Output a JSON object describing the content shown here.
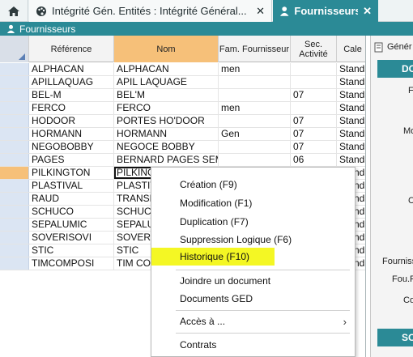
{
  "tabs": [
    {
      "label": "Intégrité Gén. Entités : Intégrité Général...",
      "icon": "palette-icon",
      "active": false
    },
    {
      "label": "Fournisseurs",
      "icon": "supplier-icon",
      "active": true
    }
  ],
  "window_title": "Fournisseurs",
  "columns": [
    "Référence",
    "Nom",
    "Fam. Fournisseur",
    "Sec. Activité",
    "Cale"
  ],
  "rows": [
    {
      "ref": "ALPHACAN",
      "nom": "ALPHACAN",
      "fam": "men",
      "sec": "",
      "cal": "Standa"
    },
    {
      "ref": "APILLAQUAG",
      "nom": "APIL LAQUAGE",
      "fam": "",
      "sec": "",
      "cal": "Standa"
    },
    {
      "ref": "BEL-M",
      "nom": "BEL'M",
      "fam": "",
      "sec": "07",
      "cal": "Standa"
    },
    {
      "ref": "FERCO",
      "nom": "FERCO",
      "fam": "men",
      "sec": "",
      "cal": "Standa"
    },
    {
      "ref": "HODOOR",
      "nom": "PORTES HO'DOOR",
      "fam": "",
      "sec": "07",
      "cal": "Standa"
    },
    {
      "ref": "HORMANN",
      "nom": "HORMANN",
      "fam": "Gen",
      "sec": "07",
      "cal": "Standa"
    },
    {
      "ref": "NEGOBOBBY",
      "nom": "NEGOCE BOBBY",
      "fam": "",
      "sec": "07",
      "cal": "Standa"
    },
    {
      "ref": "PAGES",
      "nom": "BERNARD PAGES SEME",
      "fam": "",
      "sec": "06",
      "cal": "Standa"
    },
    {
      "ref": "PILKINGTON",
      "nom": "PILKING",
      "fam": "",
      "sec": "",
      "cal": "Standa"
    },
    {
      "ref": "PLASTIVAL",
      "nom": "PLASTIV",
      "fam": "",
      "sec": "",
      "cal": "Standa"
    },
    {
      "ref": "RAUD",
      "nom": "TRANSF",
      "fam": "",
      "sec": "",
      "cal": "Standa"
    },
    {
      "ref": "SCHUCO",
      "nom": "SCHUCO",
      "fam": "",
      "sec": "",
      "cal": "Standa"
    },
    {
      "ref": "SEPALUMIC",
      "nom": "SEPALU",
      "fam": "",
      "sec": "",
      "cal": "Standa"
    },
    {
      "ref": "SOVERISOVI",
      "nom": "SOVERIS",
      "fam": "",
      "sec": "",
      "cal": "Standa"
    },
    {
      "ref": "STIC",
      "nom": "STIC",
      "fam": "",
      "sec": "",
      "cal": "Standa"
    },
    {
      "ref": "TIMCOMPOSI",
      "nom": "TIM COM",
      "fam": "",
      "sec": "",
      "cal": "Standa"
    }
  ],
  "active_row": 8,
  "right_panel": {
    "toolbar_label": "Génér",
    "band_top": "DO",
    "band_bottom": "SO",
    "labels": [
      "F",
      "Mo",
      "C",
      "Fournisse",
      "Fou.F",
      "Co"
    ]
  },
  "context_menu": {
    "items": [
      {
        "label": "Création (F9)",
        "highlight": false
      },
      {
        "label": "Modification (F1)",
        "highlight": false
      },
      {
        "label": "Duplication (F7)",
        "highlight": false
      },
      {
        "label": "Suppression Logique (F6)",
        "highlight": false
      },
      {
        "label": "Historique (F10)",
        "highlight": true
      },
      {
        "label": "Joindre un document",
        "highlight": false
      },
      {
        "label": "Documents GED",
        "highlight": false
      },
      {
        "label": "Accès à ...",
        "highlight": false,
        "submenu": true
      },
      {
        "label": "Contrats",
        "highlight": false
      }
    ]
  },
  "colors": {
    "accent": "#2b8a96",
    "highlight": "#f4f724",
    "sort_header": "#f6c079"
  }
}
